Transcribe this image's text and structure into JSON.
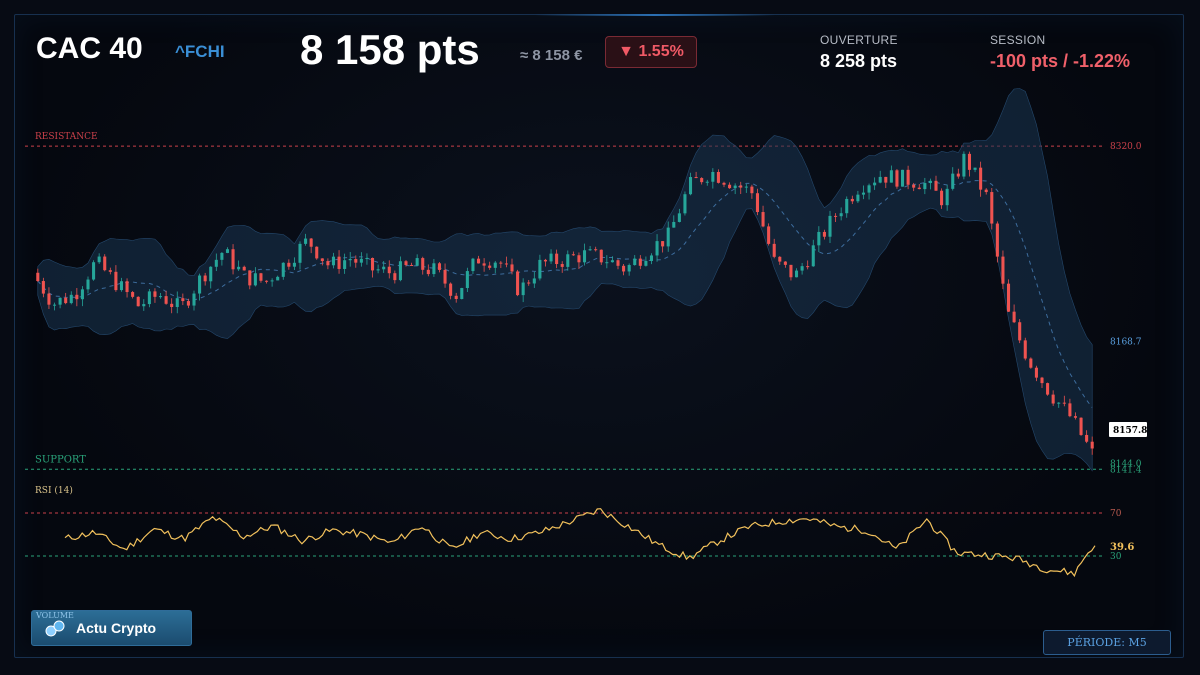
{
  "header": {
    "ticker_name": "CAC 40",
    "ticker_symbol": "^FCHI",
    "price": "8 158 pts",
    "price_eur": "≈ 8 158 €",
    "change": "▼ 1.55%",
    "open_label": "OUVERTURE",
    "open_value": "8 258 pts",
    "session_label": "SESSION",
    "session_value": "-100 pts / -1.22%"
  },
  "colors": {
    "up": "#26a69a",
    "down": "#ef5350",
    "resistance": "#c9404a",
    "support": "#2aa37a",
    "band": "#1a3450",
    "rsi": "#f2c15c",
    "accent": "#3a8fd6"
  },
  "chart_data": [
    {
      "type": "candlestick",
      "title": "",
      "y_range": [
        8141,
        8330
      ],
      "levels": {
        "resistance": {
          "label": "RESISTANCE",
          "value": 8320.0,
          "value_label": "8320.0"
        },
        "support": {
          "label": "SUPPORT",
          "value": 8141.4,
          "value_label": "8141.4"
        }
      },
      "bands_label": "8144.0",
      "upper_band_label": "8168.7",
      "last_price_label": "8157.8",
      "close_path": [
        [
          0,
          8250
        ],
        [
          4,
          8233
        ],
        [
          8,
          8238
        ],
        [
          12,
          8256
        ],
        [
          16,
          8244
        ],
        [
          20,
          8232
        ],
        [
          24,
          8238
        ],
        [
          28,
          8230
        ],
        [
          32,
          8248
        ],
        [
          36,
          8262
        ],
        [
          40,
          8248
        ],
        [
          44,
          8245
        ],
        [
          48,
          8256
        ],
        [
          52,
          8268
        ],
        [
          56,
          8254
        ],
        [
          60,
          8258
        ],
        [
          64,
          8252
        ],
        [
          68,
          8250
        ],
        [
          72,
          8254
        ],
        [
          76,
          8251
        ],
        [
          80,
          8238
        ],
        [
          84,
          8258
        ],
        [
          88,
          8257
        ],
        [
          92,
          8240
        ],
        [
          96,
          8255
        ],
        [
          100,
          8257
        ],
        [
          104,
          8260
        ],
        [
          108,
          8258
        ],
        [
          112,
          8252
        ],
        [
          116,
          8262
        ],
        [
          120,
          8270
        ],
        [
          124,
          8298
        ],
        [
          128,
          8306
        ],
        [
          132,
          8300
        ],
        [
          136,
          8294
        ],
        [
          140,
          8256
        ],
        [
          144,
          8248
        ],
        [
          148,
          8266
        ],
        [
          152,
          8284
        ],
        [
          156,
          8298
        ],
        [
          160,
          8304
        ],
        [
          164,
          8302
        ],
        [
          168,
          8300
        ],
        [
          172,
          8290
        ],
        [
          176,
          8314
        ],
        [
          180,
          8292
        ],
        [
          184,
          8228
        ],
        [
          188,
          8202
        ],
        [
          192,
          8184
        ],
        [
          196,
          8170
        ],
        [
          200,
          8150
        ]
      ]
    },
    {
      "type": "line",
      "title": "RSI (14)",
      "y_range": [
        0,
        100
      ],
      "levels": [
        {
          "value": 70,
          "label": "70"
        },
        {
          "value": 30,
          "label": "30"
        }
      ],
      "last_value_label": "39.6",
      "path": [
        [
          0,
          46
        ],
        [
          6,
          52
        ],
        [
          12,
          36
        ],
        [
          18,
          55
        ],
        [
          24,
          46
        ],
        [
          30,
          66
        ],
        [
          36,
          48
        ],
        [
          42,
          58
        ],
        [
          48,
          44
        ],
        [
          54,
          54
        ],
        [
          60,
          50
        ],
        [
          66,
          42
        ],
        [
          72,
          58
        ],
        [
          78,
          36
        ],
        [
          84,
          52
        ],
        [
          90,
          46
        ],
        [
          96,
          52
        ],
        [
          102,
          62
        ],
        [
          108,
          73
        ],
        [
          114,
          57
        ],
        [
          120,
          40
        ],
        [
          126,
          28
        ],
        [
          132,
          44
        ],
        [
          138,
          57
        ],
        [
          144,
          62
        ],
        [
          150,
          65
        ],
        [
          156,
          57
        ],
        [
          162,
          54
        ],
        [
          168,
          36
        ],
        [
          174,
          64
        ],
        [
          180,
          33
        ],
        [
          186,
          31
        ],
        [
          192,
          28
        ],
        [
          198,
          18
        ],
        [
          204,
          14
        ],
        [
          206,
          30
        ],
        [
          208,
          39.6
        ]
      ]
    }
  ],
  "badges": {
    "volume_label": "VOLUME",
    "crypto_label": "Actu Crypto",
    "period_label": "PÉRIODE: M5"
  }
}
